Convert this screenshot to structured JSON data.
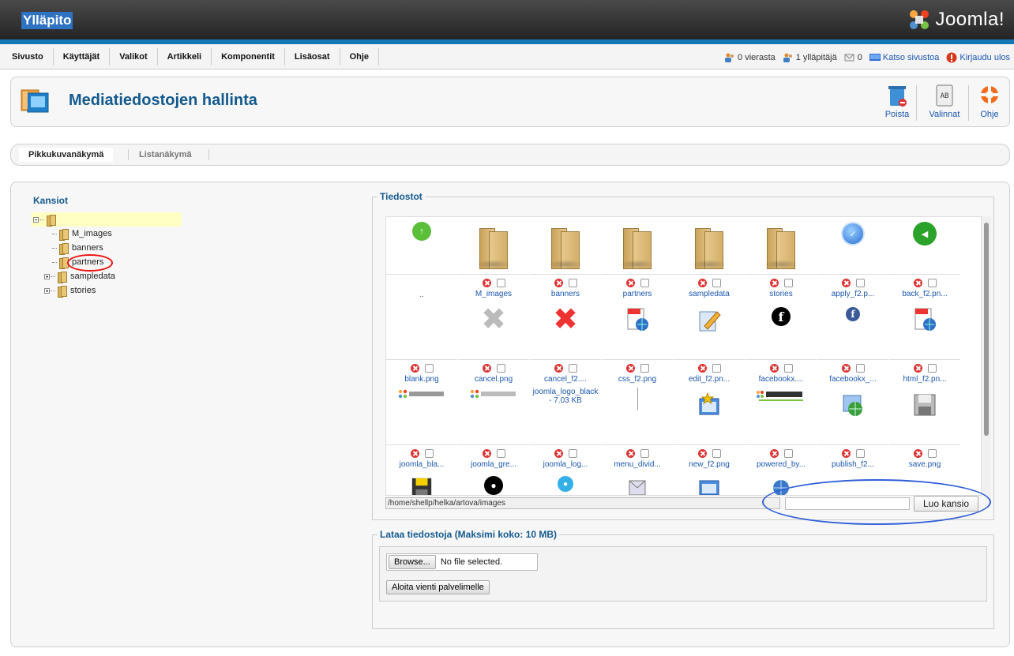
{
  "header": {
    "title": "Ylläpito",
    "logo_text": "Joomla!"
  },
  "menu": [
    {
      "label": "Sivusto"
    },
    {
      "label": "Käyttäjät"
    },
    {
      "label": "Valikot"
    },
    {
      "label": "Artikkeli"
    },
    {
      "label": "Komponentit"
    },
    {
      "label": "Lisäosat"
    },
    {
      "label": "Ohje"
    }
  ],
  "status": {
    "visitors": "0 vierasta",
    "admins": "1 ylläpitäjä",
    "messages": "0",
    "view_site": "Katso sivustoa",
    "logout": "Kirjaudu ulos"
  },
  "toolbar": {
    "page_title": "Mediatiedostojen hallinta",
    "delete_label": "Poista",
    "options_label": "Valinnat",
    "help_label": "Ohje"
  },
  "tabs": {
    "thumbs": "Pikkukuvanäkymä",
    "list": "Listanäkymä"
  },
  "folders": {
    "title": "Kansiot",
    "items": [
      "M_images",
      "banners",
      "partners",
      "sampledata",
      "stories"
    ]
  },
  "files": {
    "title": "Tiedostot",
    "up_label": "..",
    "items": [
      "M_images",
      "banners",
      "partners",
      "sampledata",
      "stories",
      "apply_f2.p...",
      "back_f2.pn...",
      "blank.png",
      "cancel.png",
      "cancel_f2....",
      "css_f2.png",
      "edit_f2.pn...",
      "facebookx....",
      "facebookx_...",
      "html_f2.pn...",
      "joomla_bla...",
      "joomla_gre...",
      "joomla_log...",
      "menu_divid...",
      "new_f2.png",
      "powered_by...",
      "publish_f2...",
      "save.png"
    ],
    "loading_text": "joomla_logo_black - 7.03 KB",
    "path": "/home/shellp/helka/artova/images",
    "folder_name_placeholder": "",
    "create_folder_label": "Luo kansio"
  },
  "upload": {
    "title": "Lataa tiedostoja (Maksimi koko: 10 MB)",
    "browse_label": "Browse...",
    "no_file": "No file selected.",
    "start_label": "Aloita vienti palvelimelle"
  },
  "colors": {
    "brand_blue": "#135a8e",
    "link_blue": "#1b57b1",
    "header_stripe": "#1478b4",
    "annotation_blue": "#2f5ed7",
    "annotation_red": "#e11111"
  }
}
